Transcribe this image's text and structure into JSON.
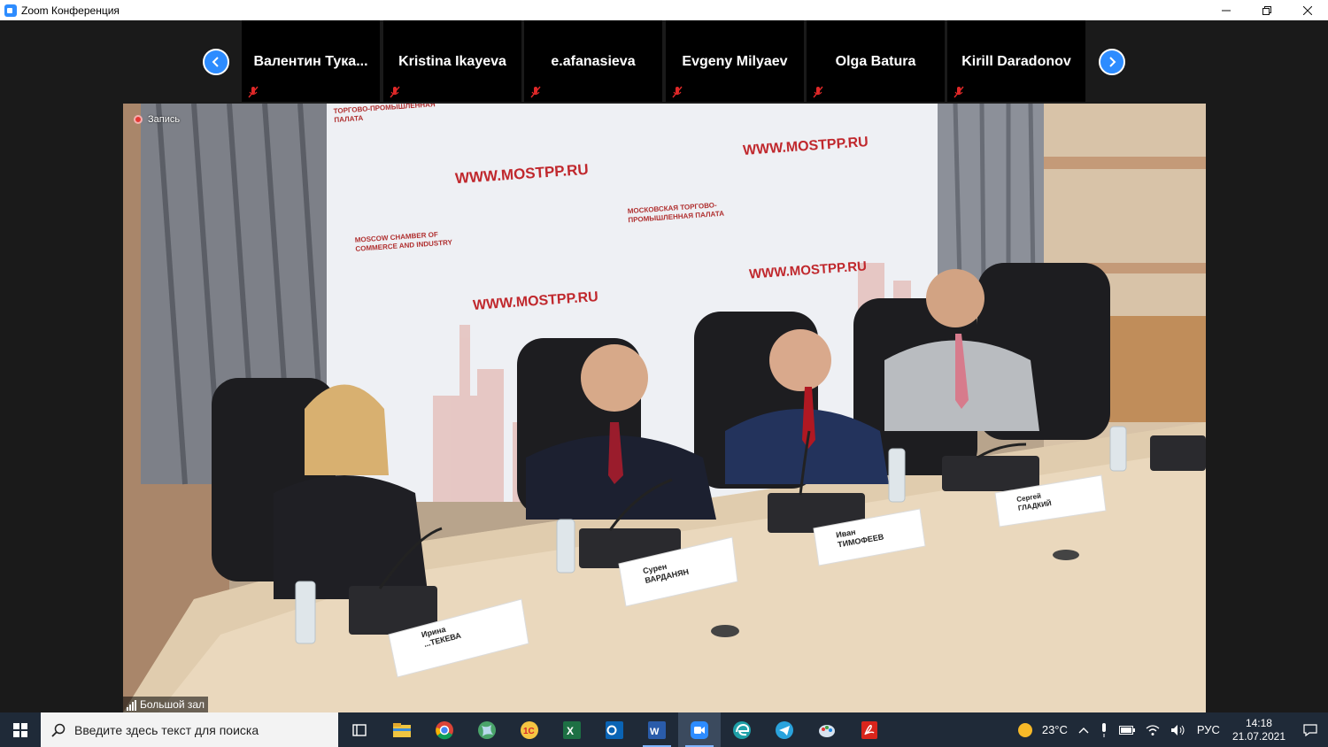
{
  "window": {
    "title": "Zoom Конференция"
  },
  "gallery": {
    "participants": [
      {
        "name": "Валентин  Тука..."
      },
      {
        "name": "Kristina Ikayeva"
      },
      {
        "name": "e.afanasieva"
      },
      {
        "name": "Evgeny Milyaev"
      },
      {
        "name": "Olga Batura"
      },
      {
        "name": "Kirill Daradonov"
      }
    ]
  },
  "video": {
    "recording_label": "Запись",
    "speaker_label": "Большой зал",
    "backdrop": {
      "url_text": "WWW.MOSTPP.RU",
      "org_ru": "МОСКОВСКАЯ ТОРГОВО-ПРОМЫШЛЕННАЯ ПАЛАТА",
      "org_en": "MOSCOW CHAMBER OF COMMERCE AND INDUSTRY",
      "top_fragment": "ТОРГОВО-ПРОМЫШЛЕННАЯ ПАЛАТА"
    },
    "nameplates": [
      {
        "line1": "Ирина",
        "line2": "...ТЕКЕВА"
      },
      {
        "line1": "Сурен",
        "line2": "ВАРДАНЯН"
      },
      {
        "line1": "Иван",
        "line2": "ТИМОФЕЕВ"
      },
      {
        "line1": "Сергей",
        "line2": "ГЛАДКИЙ"
      }
    ]
  },
  "taskbar": {
    "search_placeholder": "Введите здесь текст для поиска",
    "weather": "23°C",
    "language": "РУС",
    "time": "14:18",
    "date": "21.07.2021"
  },
  "colors": {
    "accent": "#2d8cff",
    "taskbar": "#1f2a38",
    "brand_red": "#c0282d"
  }
}
